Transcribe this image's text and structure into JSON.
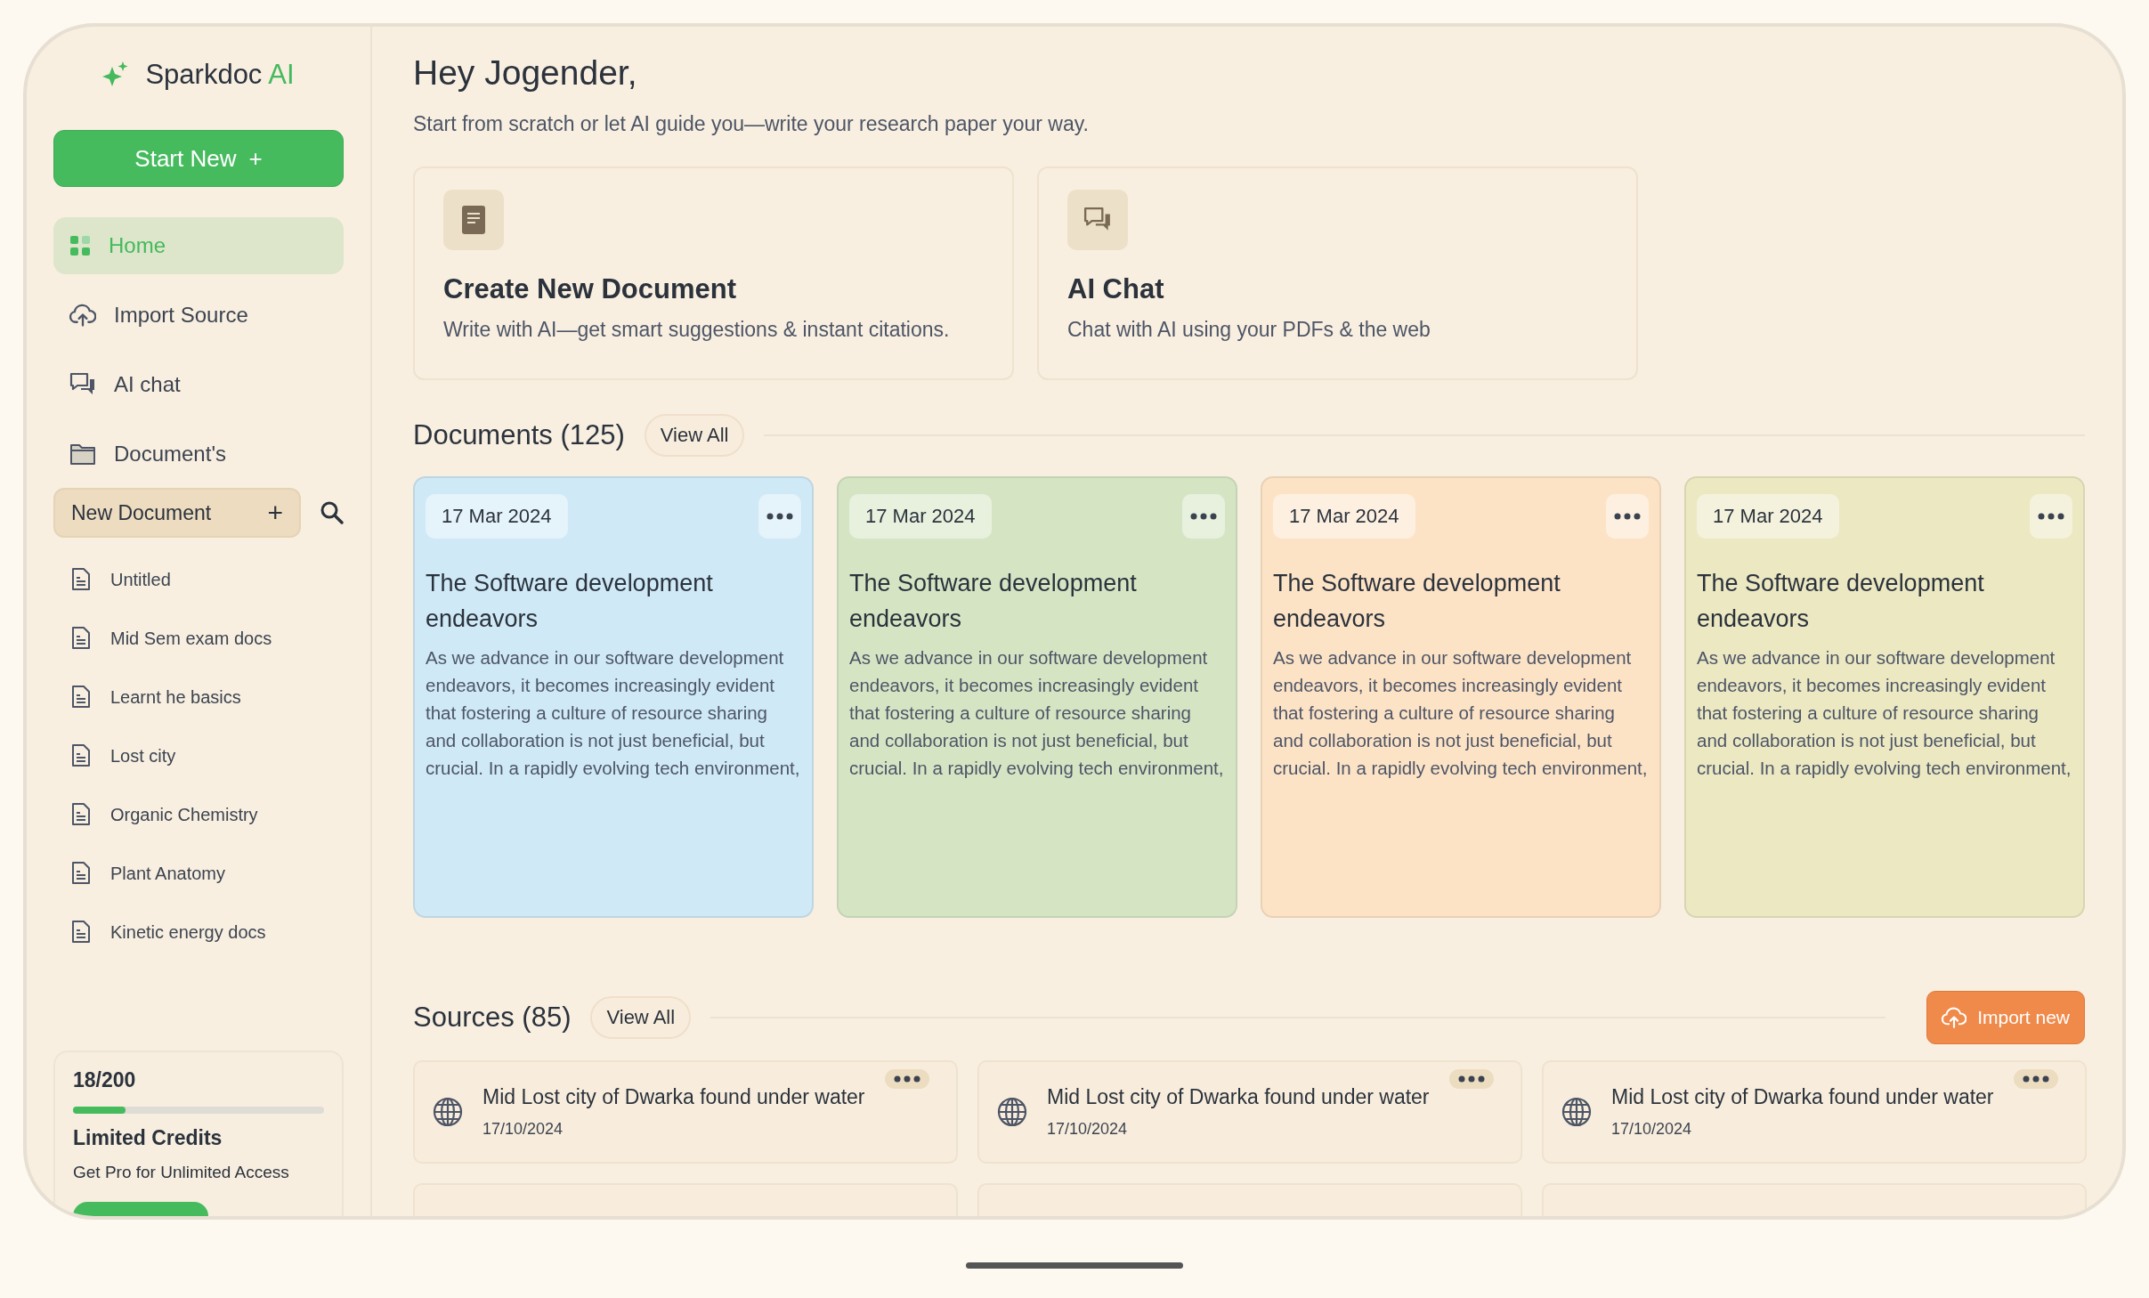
{
  "sidebar": {
    "logo": {
      "name": "Sparkdoc",
      "accent": "AI"
    },
    "start_button": {
      "label": "Start New",
      "icon": "+"
    },
    "nav": [
      {
        "label": "Home",
        "kind": "home",
        "selected": true
      },
      {
        "label": "Import Source",
        "kind": "import",
        "selected": false
      },
      {
        "label": "AI chat",
        "kind": "chat",
        "selected": false
      },
      {
        "label": "Document's",
        "kind": "folder",
        "selected": false
      }
    ],
    "new_document": {
      "label": "New Document",
      "icon": "+"
    },
    "documents": [
      "Untitled",
      "Mid Sem exam docs",
      "Learnt he basics",
      "Lost city",
      "Organic Chemistry",
      "Plant Anatomy",
      "Kinetic energy docs"
    ],
    "credits": {
      "count": "18/200",
      "level": 0.21,
      "title": "Limited Credits",
      "subtitle": "Get Pro for Unlimited Access"
    }
  },
  "main": {
    "greeting": "Hey Jogender,",
    "subtitle": "Start from scratch or let AI guide you—write your research paper your way.",
    "actions": [
      {
        "kind": "document",
        "title": "Create New Document",
        "description": "Write with AI—get smart suggestions & instant citations."
      },
      {
        "kind": "chat",
        "title": "AI Chat",
        "description": "Chat with AI using your PDFs & the web"
      }
    ],
    "documents": {
      "title": "Documents (125)",
      "view_all": "View All",
      "cards": [
        {
          "date": "17 Mar 2024",
          "title": "The Software development endeavors",
          "excerpt": "As we advance in our software development endeavors, it becomes increasingly evident that fostering a culture of resource sharing and collaboration is not just beneficial, but crucial. In a rapidly evolving tech environment,",
          "color": "#cfe9f6"
        },
        {
          "date": "17 Mar 2024",
          "title": "The Software development endeavors",
          "excerpt": "As we advance in our software development endeavors, it becomes increasingly evident that fostering a culture of resource sharing and collaboration is not just beneficial, but crucial. In a rapidly evolving tech environment,",
          "color": "#d5e5c4"
        },
        {
          "date": "17 Mar 2024",
          "title": "The Software development endeavors",
          "excerpt": "As we advance in our software development endeavors, it becomes increasingly evident that fostering a culture of resource sharing and collaboration is not just beneficial, but crucial. In a rapidly evolving tech environment,",
          "color": "#fde3c6"
        },
        {
          "date": "17 Mar 2024",
          "title": "The Software development endeavors",
          "excerpt": "As we advance in our software development endeavors, it becomes increasingly evident that fostering a culture of resource sharing and collaboration is not just beneficial, but crucial. In a rapidly evolving tech environment,",
          "color": "#ebe8c2"
        }
      ]
    },
    "sources": {
      "title": "Sources (85)",
      "view_all": "View All",
      "import_button": "Import new",
      "items": [
        {
          "title": "Mid Lost city of Dwarka found under water",
          "date": "17/10/2024"
        },
        {
          "title": "Mid Lost city of Dwarka found under water",
          "date": "17/10/2024"
        },
        {
          "title": "Mid Lost city of Dwarka found under water",
          "date": "17/10/2024"
        }
      ]
    }
  }
}
